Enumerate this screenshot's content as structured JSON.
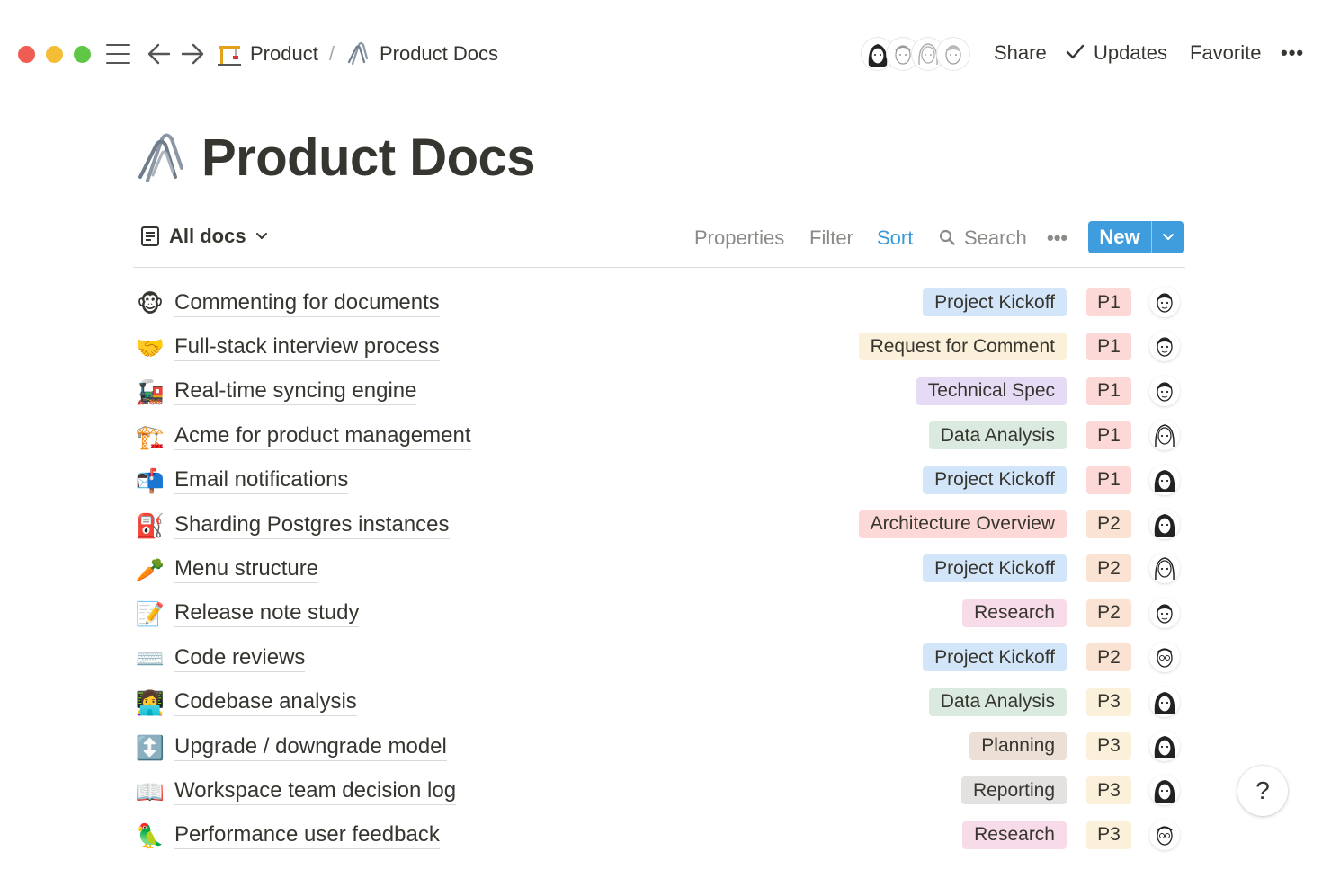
{
  "window": {
    "traffic_lights": [
      "close",
      "minimize",
      "zoom"
    ]
  },
  "breadcrumb": {
    "items": [
      {
        "label": "Product",
        "icon": "construction-crane-icon"
      },
      {
        "label": "Product Docs",
        "icon": "paperclips-icon"
      }
    ],
    "separator": "/"
  },
  "header_actions": {
    "share": "Share",
    "updates": "Updates",
    "favorite": "Favorite",
    "more": "•••"
  },
  "page": {
    "title": "Product Docs",
    "icon": "paperclips-icon"
  },
  "toolbar": {
    "view_label": "All docs",
    "properties": "Properties",
    "filter": "Filter",
    "sort": "Sort",
    "search": "Search",
    "more": "•••",
    "new_label": "New"
  },
  "colors": {
    "accent": "#3f9dde",
    "sort_active": "#3a99d8",
    "tag_blue": "#d3e5f8",
    "tag_yellow": "#fbf0d9",
    "tag_purple": "#e6dbf5",
    "tag_green": "#dbeadf",
    "tag_red": "#fcd9d6",
    "tag_pink": "#f8dbe8",
    "tag_brown": "#ecdfd6",
    "tag_gray": "#e3e2e0",
    "prio_p1": "#fcd9d6",
    "prio_p2": "#fbe3d3",
    "prio_p3": "#fbf0d9"
  },
  "docs": [
    {
      "icon": "🐵",
      "title": "Commenting for documents",
      "type": "Project Kickoff",
      "priority": "P1"
    },
    {
      "icon": "🤝",
      "title": "Full-stack interview process",
      "type": "Request for Comment",
      "priority": "P1"
    },
    {
      "icon": "🚂",
      "title": "Real-time syncing engine",
      "type": "Technical Spec",
      "priority": "P1"
    },
    {
      "icon": "🏗️",
      "title": "Acme for product management",
      "type": "Data Analysis",
      "priority": "P1"
    },
    {
      "icon": "📬",
      "title": "Email notifications",
      "type": "Project Kickoff",
      "priority": "P1"
    },
    {
      "icon": "⛽",
      "title": "Sharding Postgres instances",
      "type": "Architecture Overview",
      "priority": "P2"
    },
    {
      "icon": "🥕",
      "title": "Menu structure",
      "type": "Project Kickoff",
      "priority": "P2"
    },
    {
      "icon": "📝",
      "title": "Release note study",
      "type": "Research",
      "priority": "P2"
    },
    {
      "icon": "⌨️",
      "title": "Code reviews",
      "type": "Project Kickoff",
      "priority": "P2"
    },
    {
      "icon": "👩‍💻",
      "title": "Codebase analysis",
      "type": "Data Analysis",
      "priority": "P3"
    },
    {
      "icon": "↕️",
      "title": "Upgrade / downgrade model",
      "type": "Planning",
      "priority": "P3"
    },
    {
      "icon": "📖",
      "title": "Workspace team decision log",
      "type": "Reporting",
      "priority": "P3"
    },
    {
      "icon": "🦜",
      "title": "Performance user feedback",
      "type": "Research",
      "priority": "P3"
    }
  ],
  "help": {
    "label": "?"
  }
}
